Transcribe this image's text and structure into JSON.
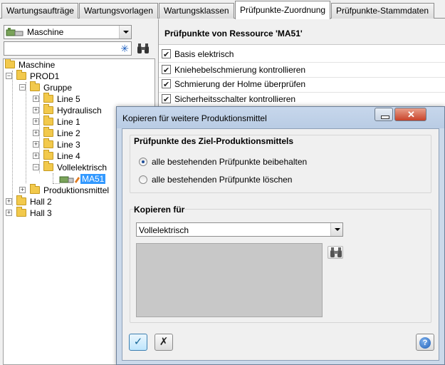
{
  "tabs": [
    {
      "label": "Wartungsaufträge",
      "active": false
    },
    {
      "label": "Wartungsvorlagen",
      "active": false
    },
    {
      "label": "Wartungsklassen",
      "active": false
    },
    {
      "label": "Prüfpunkte-Zuordnung",
      "active": true
    },
    {
      "label": "Prüfpunkte-Stammdaten",
      "active": false
    }
  ],
  "left": {
    "combo_value": "Maschine",
    "search_value": "",
    "tree": [
      {
        "label": "Maschine",
        "level": 0
      },
      {
        "label": "PROD1",
        "level": 1
      },
      {
        "label": "Gruppe",
        "level": 2
      },
      {
        "label": "Line 5",
        "level": 3
      },
      {
        "label": "Hydraulisch",
        "level": 3
      },
      {
        "label": "Line 1",
        "level": 3
      },
      {
        "label": "Line 2",
        "level": 3
      },
      {
        "label": "Line 3",
        "level": 3
      },
      {
        "label": "Line 4",
        "level": 3
      },
      {
        "label": "Vollelektrisch",
        "level": 3
      },
      {
        "label": "MA51",
        "level": 4,
        "selected": true
      },
      {
        "label": "Produktionsmittel",
        "level": 2
      },
      {
        "label": "Hall 2",
        "level": 1
      },
      {
        "label": "Hall 3",
        "level": 1
      }
    ]
  },
  "right": {
    "header": "Prüfpunkte von Ressource 'MA51'",
    "items": [
      {
        "label": "Basis elektrisch",
        "checked": true
      },
      {
        "label": "Kniehebelschmierung kontrollieren",
        "checked": true
      },
      {
        "label": "Schmierung der Holme überprüfen",
        "checked": true
      },
      {
        "label": "Sicherheitsschalter kontrollieren",
        "checked": true
      }
    ]
  },
  "dialog": {
    "title": "Kopieren für weitere Produktionsmittel",
    "group1_title": "Prüfpunkte des Ziel-Produktionsmittels",
    "option_keep": "alle bestehenden Prüfpunkte beibehalten",
    "option_delete": "alle bestehenden Prüfpunkte löschen",
    "selected_option": "keep",
    "group2_title": "Kopieren für",
    "copy_for_value": "Vollelektrisch",
    "ok_symbol": "✓",
    "cancel_symbol": "✗",
    "help_symbol": "?"
  }
}
